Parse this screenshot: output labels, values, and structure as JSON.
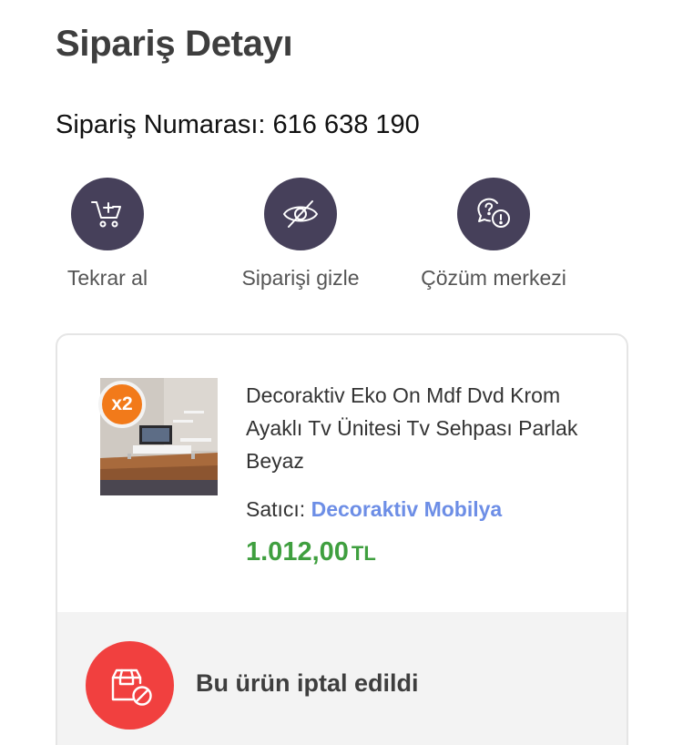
{
  "page": {
    "title": "Sipariş Detayı"
  },
  "order": {
    "number_label": "Sipariş Numarası: 616 638 190"
  },
  "actions": [
    {
      "label": "Tekrar al",
      "icon": "cart-plus-icon"
    },
    {
      "label": "Siparişi gizle",
      "icon": "eye-off-icon"
    },
    {
      "label": "Çözüm merkezi",
      "icon": "help-chat-icon"
    }
  ],
  "product": {
    "quantity_badge": "x2",
    "name": "Decoraktiv Eko On Mdf Dvd Krom Ayaklı Tv Ünitesi Tv Sehpası Parlak Beyaz",
    "seller_label": "Satıcı:",
    "seller_name": "Decoraktiv Mobilya",
    "price": "1.012,00",
    "currency": "TL"
  },
  "status": {
    "text": "Bu ürün iptal edildi",
    "icon": "cancelled-box-icon"
  },
  "colors": {
    "action_circle": "#46405a",
    "badge_orange": "#f27a1a",
    "seller_link": "#6d8ee6",
    "price_green": "#3f9f3f",
    "cancel_red": "#f1403f"
  }
}
